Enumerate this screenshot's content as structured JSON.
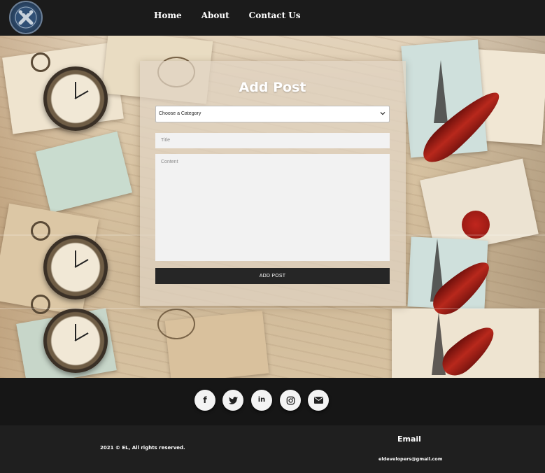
{
  "nav": {
    "logo_icon": "shield-logo-icon",
    "items": [
      {
        "label": "Home"
      },
      {
        "label": "About"
      },
      {
        "label": "Contact Us"
      }
    ]
  },
  "form": {
    "title": "Add Post",
    "category_select": {
      "value": "Choose a Category"
    },
    "title_input": {
      "placeholder": "Title"
    },
    "content_input": {
      "placeholder": "Content"
    },
    "submit_label": "ADD POST"
  },
  "social": [
    {
      "icon": "facebook-icon",
      "glyph": "f"
    },
    {
      "icon": "twitter-icon",
      "glyph": "t"
    },
    {
      "icon": "linkedin-icon",
      "glyph": "in"
    },
    {
      "icon": "instagram-icon",
      "glyph": "◎"
    },
    {
      "icon": "email-icon",
      "glyph": "✉"
    }
  ],
  "footer": {
    "copyright": "2021 © EL, All rights reserved.",
    "email_heading": "Email",
    "email_value": "eldevelopers@gmail.com"
  },
  "colors": {
    "header_bg": "#1b1b1b",
    "button_bg": "#262626",
    "feather_red": "#b8281c"
  }
}
